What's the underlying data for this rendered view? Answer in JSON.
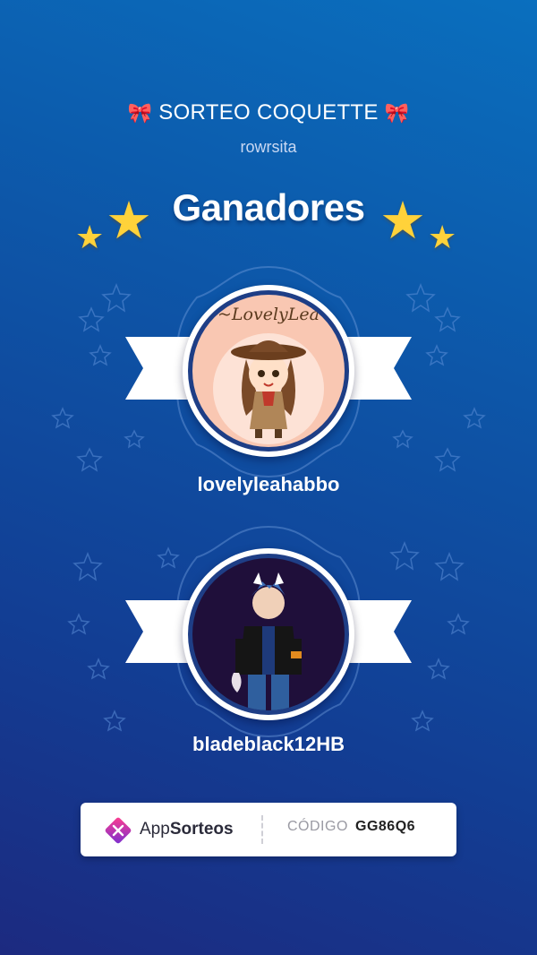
{
  "header": {
    "title": "SORTEO COQUETTE",
    "bow_icon": "ribbon-bow",
    "subtitle": "rowrsita"
  },
  "heading": "Ganadores",
  "winners": [
    {
      "name": "lovelyleahabbo",
      "avatar_text": "~LovelyLea"
    },
    {
      "name": "bladeblack12HB"
    }
  ],
  "footer": {
    "brand_prefix": "App",
    "brand_suffix": "Sorteos",
    "code_label": "CÓDIGO",
    "code_value": "GG86Q6"
  },
  "colors": {
    "background_top": "#0a6fbe",
    "background_bottom": "#1c2a80",
    "star": "#ffd23a",
    "bow": "#ff7fb0",
    "ring": "#1e3e86"
  }
}
